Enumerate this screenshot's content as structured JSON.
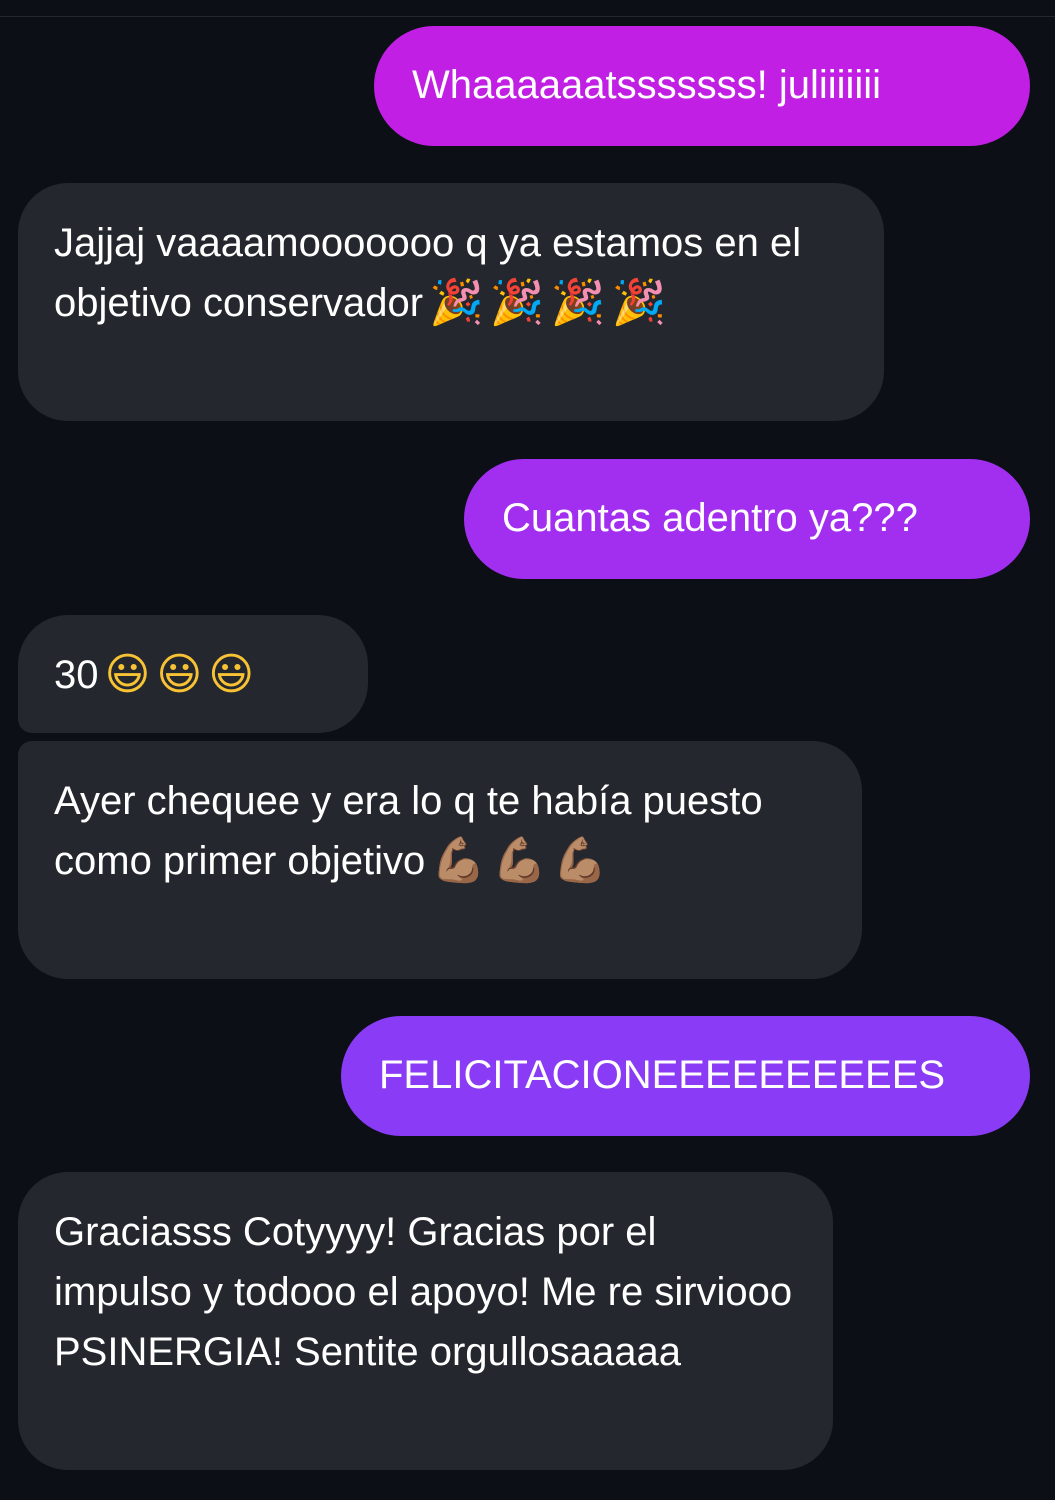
{
  "chat": {
    "messages": [
      {
        "direction": "outgoing",
        "text": "Whaaaaaatsssssss! juliiiiiii",
        "emojis": []
      },
      {
        "direction": "incoming",
        "text": "Jajjaj vaaaamooooooo q ya estamos en el objetivo conservador",
        "emojis": [
          "🎉",
          "🎉",
          "🎉",
          "🎉"
        ]
      },
      {
        "direction": "outgoing",
        "text": "Cuantas adentro ya???",
        "emojis": []
      },
      {
        "direction": "incoming",
        "text": "30",
        "emojis": [
          "😃",
          "😃",
          "😃"
        ]
      },
      {
        "direction": "incoming",
        "text": "Ayer chequee y era lo q te había puesto como primer objetivo",
        "emojis": [
          "💪🏽",
          "💪🏽",
          "💪🏽"
        ]
      },
      {
        "direction": "outgoing",
        "text": "FELICITACIONEEEEEEEEEES",
        "emojis": []
      },
      {
        "direction": "incoming",
        "text": "Graciasss Cotyyyy! Gracias por el impulso y todooo el apoyo! Me re sirviooo PSINERGIA! Sentite orgullosaaaaa",
        "emojis": []
      }
    ]
  },
  "colors": {
    "background": "#0c1016",
    "incoming_bubble": "#24272d",
    "outgoing_bubble_1": "#c11fe3",
    "outgoing_bubble_2": "#a22ff0",
    "outgoing_bubble_3": "#8a3bf5",
    "text": "#ffffff"
  },
  "icons": {
    "party": "party-popper-icon",
    "smile": "grinning-face-icon",
    "muscle": "flexed-biceps-icon"
  }
}
